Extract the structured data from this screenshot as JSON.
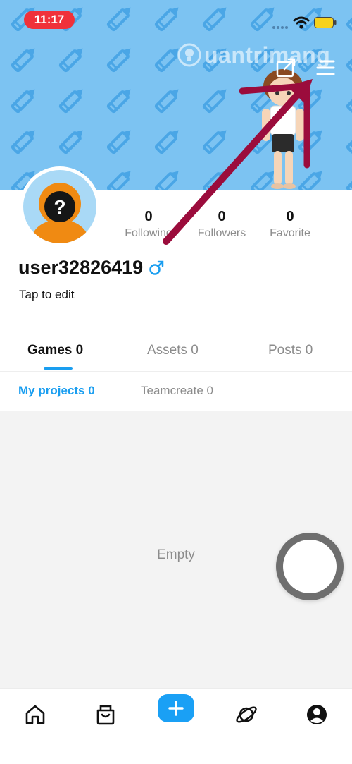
{
  "status_bar": {
    "time": "11:17"
  },
  "watermark": {
    "text": "uantrimang"
  },
  "profile": {
    "stats": [
      {
        "value": "0",
        "label": "Following"
      },
      {
        "value": "0",
        "label": "Followers"
      },
      {
        "value": "0",
        "label": "Favorite"
      }
    ],
    "username": "user32826419",
    "gender_symbol": "♂",
    "bio": "Tap to edit"
  },
  "tabs": [
    {
      "label": "Games 0",
      "active": true
    },
    {
      "label": "Assets 0",
      "active": false
    },
    {
      "label": "Posts 0",
      "active": false
    }
  ],
  "subtabs": [
    {
      "label": "My projects 0",
      "active": true
    },
    {
      "label": "Teamcreate 0",
      "active": false
    }
  ],
  "content": {
    "empty_text": "Empty"
  },
  "bottom_nav": {
    "items": [
      "home-icon",
      "shop-bag-icon",
      "plus-icon",
      "planet-icon",
      "profile-icon"
    ]
  },
  "colors": {
    "accent": "#1a9ef0",
    "banner": "#7cc3f2",
    "time_pill": "#f0313a",
    "annotation_arrow": "#9b0c3c",
    "avatar_orange": "#f08a12"
  }
}
